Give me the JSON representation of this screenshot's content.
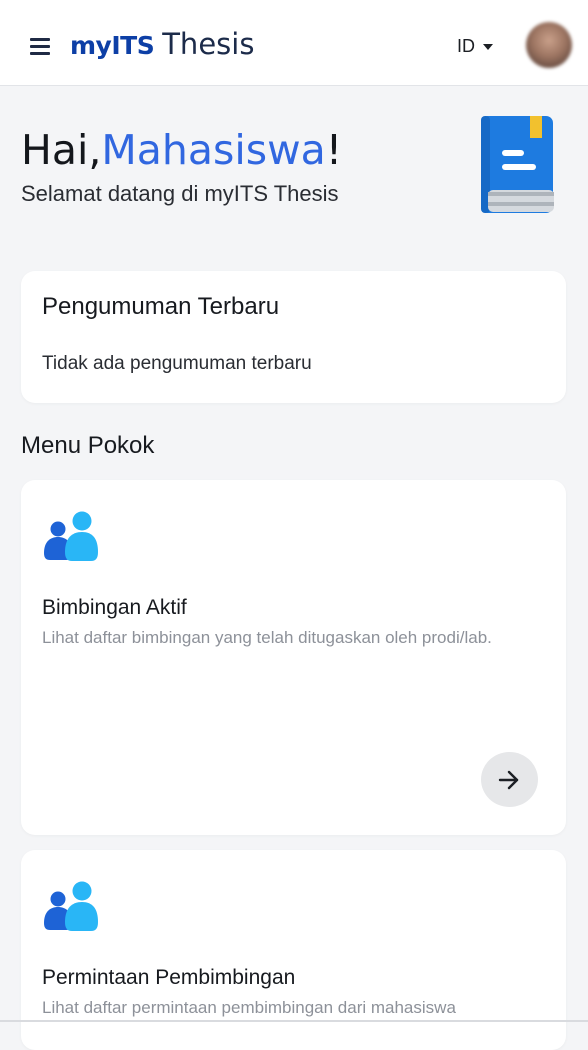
{
  "header": {
    "logo_my": "myITS",
    "logo_app": "Thesis",
    "language": "ID",
    "icons": {
      "menu": "hamburger-menu-icon",
      "language_caret": "caret-down-icon",
      "avatar": "user-avatar"
    }
  },
  "greeting": {
    "hai": "Hai,",
    "name": "Mahasiswa",
    "exclaim": "!",
    "welcome": "Selamat datang di myITS Thesis",
    "icon": "book-icon"
  },
  "announcement": {
    "title": "Pengumuman Terbaru",
    "empty_text": "Tidak ada pengumuman terbaru"
  },
  "menu": {
    "section_title": "Menu Pokok",
    "items": [
      {
        "title": "Bimbingan Aktif",
        "description": "Lihat daftar bimbingan yang telah ditugaskan oleh prodi/lab.",
        "icon": "people-icon",
        "action_icon": "arrow-right-icon"
      },
      {
        "title": "Permintaan Pembimbingan",
        "description": "Lihat daftar permintaan pembimbingan dari mahasiswa",
        "icon": "people-icon"
      }
    ]
  },
  "colors": {
    "accent": "#3167e0",
    "brand_dark": "#0d3fa6",
    "icon_blue": "#1e88e5",
    "icon_light_blue": "#29b6f6",
    "book_yellow": "#f2c12e",
    "background": "#f4f5f7"
  }
}
